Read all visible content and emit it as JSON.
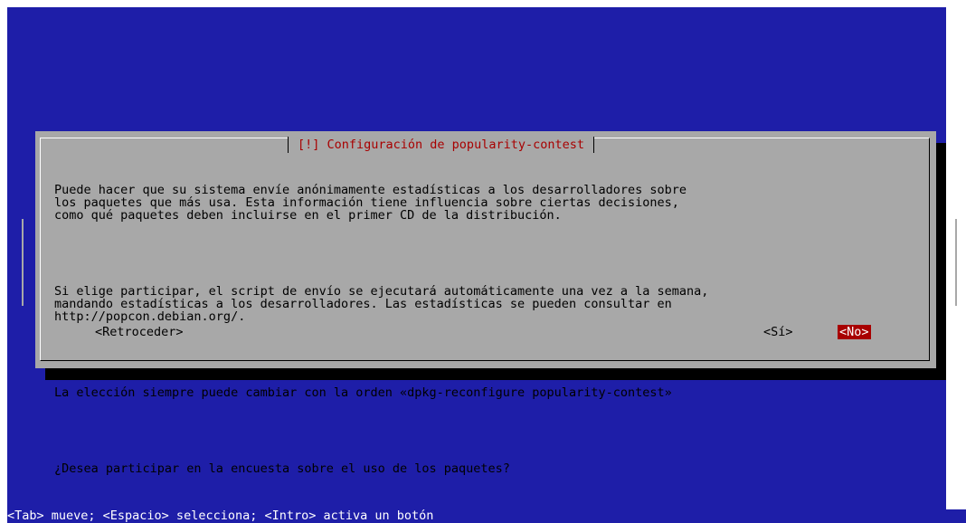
{
  "dialog": {
    "title": "[!] Configuración de popularity-contest",
    "paragraph1": "Puede hacer que su sistema envíe anónimamente estadísticas a los desarrolladores sobre\nlos paquetes que más usa. Esta información tiene influencia sobre ciertas decisiones,\ncomo qué paquetes deben incluirse en el primer CD de la distribución.",
    "paragraph2": "Si elige participar, el script de envío se ejecutará automáticamente una vez a la semana,\nmandando estadísticas a los desarrolladores. Las estadísticas se pueden consultar en\nhttp://popcon.debian.org/.",
    "paragraph3": "La elección siempre puede cambiar con la orden «dpkg-reconfigure popularity-contest»",
    "question": "¿Desea participar en la encuesta sobre el uso de los paquetes?",
    "buttons": {
      "back": "<Retroceder>",
      "yes": "<Sí>",
      "no": "<No>"
    },
    "selected_button": "no"
  },
  "status_bar": "<Tab> mueve; <Espacio> selecciona; <Intro> activa un botón",
  "colors": {
    "background": "#1e1ea8",
    "dialog": "#a8a8a8",
    "title_text": "#a80000",
    "selected_button_bg": "#a80000",
    "shadow": "#000000"
  }
}
